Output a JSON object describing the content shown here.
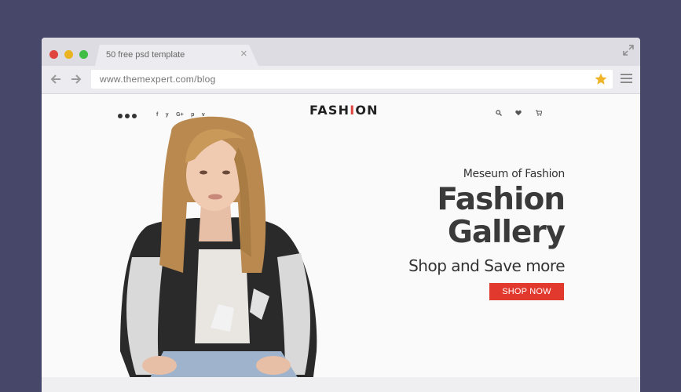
{
  "browser": {
    "tab_title": "50 free psd  template",
    "tab_close": "×",
    "url": "www.themexpert.com/blog"
  },
  "site": {
    "logo_before": "FASH",
    "logo_accent": "I",
    "logo_after": "ON",
    "social_icons": [
      "f",
      "y",
      "G+",
      "p",
      "v"
    ],
    "header_icons": [
      "search-icon",
      "heart-icon",
      "cart-icon"
    ]
  },
  "hero": {
    "subtitle": "Meseum of Fashion",
    "title_line1": "Fashion",
    "title_line2": "Gallery",
    "tagline": "Shop and Save more",
    "button": "SHOP NOW"
  },
  "colors": {
    "background": "#47476a",
    "accent": "#e2392f",
    "star": "#f0b429"
  }
}
